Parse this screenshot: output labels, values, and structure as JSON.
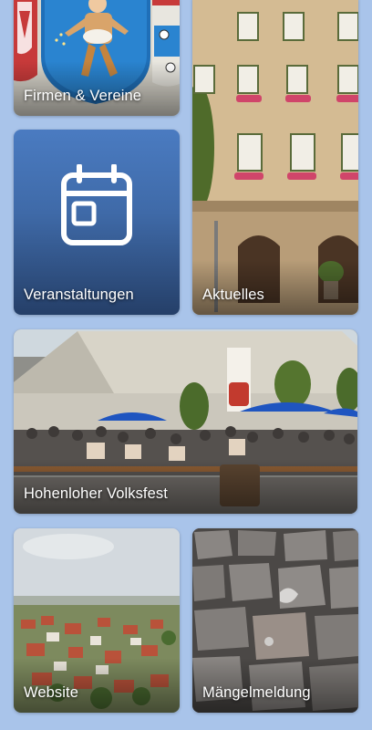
{
  "tiles": {
    "firmen": {
      "label": "Firmen & Vereine",
      "image": "coat-of-arms"
    },
    "veranstaltungen": {
      "label": "Veranstaltungen",
      "icon": "calendar-icon"
    },
    "aktuelles": {
      "label": "Aktuelles",
      "image": "town-hall-building"
    },
    "volksfest": {
      "label": "Hohenloher Volksfest",
      "image": "festival-tent"
    },
    "website": {
      "label": "Website",
      "image": "town-aerial-view"
    },
    "maengelmeldung": {
      "label": "Mängelmeldung",
      "image": "cobblestones"
    }
  },
  "colors": {
    "background": "#a9c4ea",
    "tile_blue_top": "#4a7bc1",
    "tile_blue_bottom": "#253f68",
    "label_text": "#ffffff"
  }
}
